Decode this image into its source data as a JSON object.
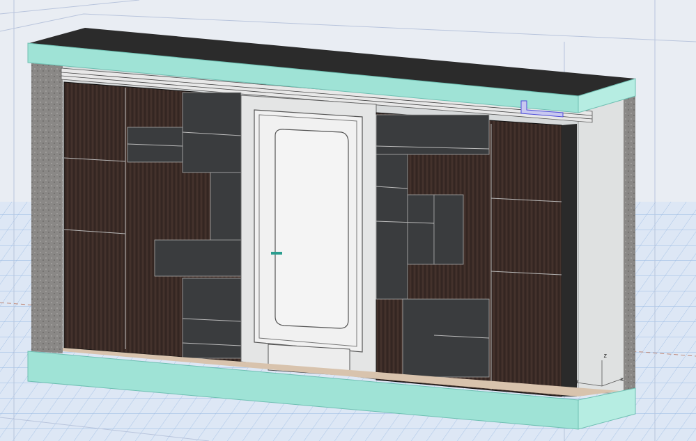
{
  "viewport": {
    "axis_labels": {
      "x": "x",
      "y": "y",
      "z": "z"
    }
  },
  "colors": {
    "background": "#e9edf3",
    "slab_cyan": "#9fe3d6",
    "slab_top": "#2b2b2b",
    "wood": "#3b2b26",
    "open_shelf": "#3a3c3e",
    "wall": "#d9dcdd",
    "selection": "#4b4bd8"
  }
}
